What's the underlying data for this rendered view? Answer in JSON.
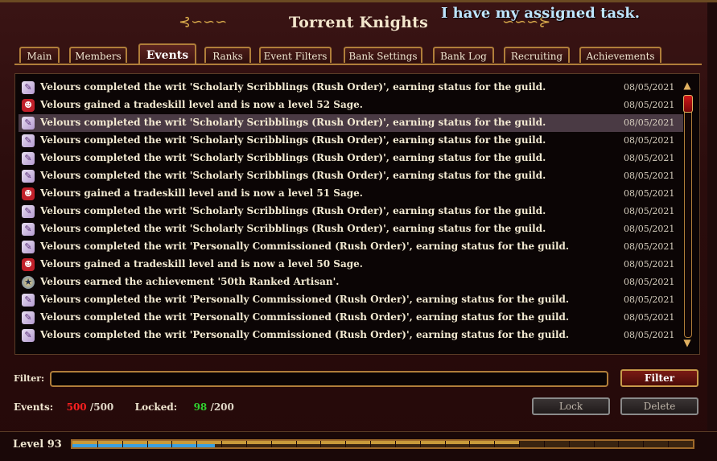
{
  "window": {
    "title": "Torrent Knights",
    "overlay_message": "I have my assigned task."
  },
  "tabs": [
    {
      "label": "Main",
      "active": false
    },
    {
      "label": "Members",
      "active": false
    },
    {
      "label": "Events",
      "active": true
    },
    {
      "label": "Ranks",
      "active": false
    },
    {
      "label": "Event Filters",
      "active": false
    },
    {
      "label": "Bank Settings",
      "active": false
    },
    {
      "label": "Bank Log",
      "active": false
    },
    {
      "label": "Recruiting",
      "active": false
    },
    {
      "label": "Achievements",
      "active": false
    }
  ],
  "events": [
    {
      "icon": "writ-scroll-icon",
      "text": "Velours completed the writ 'Scholarly Scribblings (Rush Order)', earning status for the guild.",
      "date": "08/05/2021"
    },
    {
      "icon": "sage-tradeskill-icon",
      "text": "Velours gained a tradeskill level and is now a level 52 Sage.",
      "date": "08/05/2021"
    },
    {
      "icon": "writ-scroll-icon",
      "text": "Velours completed the writ 'Scholarly Scribblings (Rush Order)', earning status for the guild.",
      "date": "08/05/2021",
      "selected": true
    },
    {
      "icon": "writ-scroll-icon",
      "text": "Velours completed the writ 'Scholarly Scribblings (Rush Order)', earning status for the guild.",
      "date": "08/05/2021"
    },
    {
      "icon": "writ-scroll-icon",
      "text": "Velours completed the writ 'Scholarly Scribblings (Rush Order)', earning status for the guild.",
      "date": "08/05/2021"
    },
    {
      "icon": "writ-scroll-icon",
      "text": "Velours completed the writ 'Scholarly Scribblings (Rush Order)', earning status for the guild.",
      "date": "08/05/2021"
    },
    {
      "icon": "sage-tradeskill-icon",
      "text": "Velours gained a tradeskill level and is now a level 51 Sage.",
      "date": "08/05/2021"
    },
    {
      "icon": "writ-scroll-icon",
      "text": "Velours completed the writ 'Scholarly Scribblings (Rush Order)', earning status for the guild.",
      "date": "08/05/2021"
    },
    {
      "icon": "writ-scroll-icon",
      "text": "Velours completed the writ 'Scholarly Scribblings (Rush Order)', earning status for the guild.",
      "date": "08/05/2021"
    },
    {
      "icon": "writ-scroll-icon",
      "text": "Velours completed the writ 'Personally Commissioned (Rush Order)', earning status for the guild.",
      "date": "08/05/2021"
    },
    {
      "icon": "sage-tradeskill-icon",
      "text": "Velours gained a tradeskill level and is now a level 50 Sage.",
      "date": "08/05/2021"
    },
    {
      "icon": "achievement-icon",
      "text": "Velours earned the achievement '50th Ranked Artisan'.",
      "date": "08/05/2021"
    },
    {
      "icon": "writ-scroll-icon",
      "text": "Velours completed the writ 'Personally Commissioned (Rush Order)', earning status for the guild.",
      "date": "08/05/2021"
    },
    {
      "icon": "writ-scroll-icon",
      "text": "Velours completed the writ 'Personally Commissioned (Rush Order)', earning status for the guild.",
      "date": "08/05/2021"
    },
    {
      "icon": "writ-scroll-icon",
      "text": "Velours completed the writ 'Personally Commissioned (Rush Order)', earning status for the guild.",
      "date": "08/05/2021"
    }
  ],
  "filter": {
    "label": "Filter:",
    "value": "",
    "button_label": "Filter"
  },
  "stats": {
    "events_label": "Events:",
    "events_count": "500",
    "events_max": "/500",
    "locked_label": "Locked:",
    "locked_count": "98",
    "locked_max": "/200"
  },
  "actions": {
    "lock_label": "Lock",
    "delete_label": "Delete"
  },
  "guild_level": {
    "label": "Level 93",
    "xp_gold_fraction": 0.72,
    "xp_blue_fraction": 0.23
  },
  "colors": {
    "accent_gold": "#b07e3a",
    "event_count_red": "#ff2020",
    "locked_count_green": "#30d030",
    "xp_blue": "#3aa0e0"
  }
}
